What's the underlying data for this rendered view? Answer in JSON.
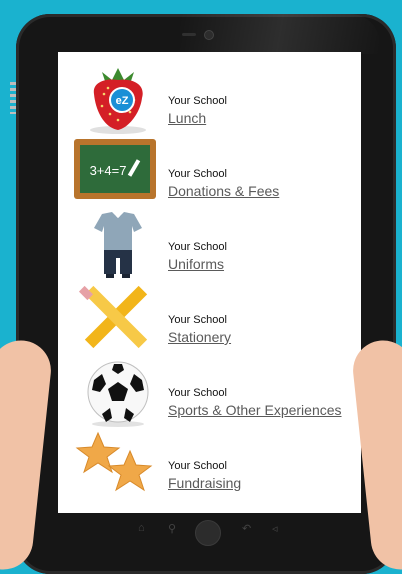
{
  "school_label": "Your School",
  "items": [
    {
      "title": "Lunch",
      "icon": "strawberry-icon"
    },
    {
      "title": "Donations & Fees",
      "icon": "chalkboard-icon"
    },
    {
      "title": "Uniforms",
      "icon": "uniform-icon"
    },
    {
      "title": "Stationery",
      "icon": "pencil-ruler-icon"
    },
    {
      "title": "Sports & Other Experiences",
      "icon": "soccer-ball-icon"
    },
    {
      "title": "Fundraising",
      "icon": "stars-icon"
    }
  ],
  "strawberry_badge": "eZ",
  "chalkboard_text": "3+4=7",
  "colors": {
    "background": "#1ab2cf",
    "tablet": "#161616",
    "link": "#5a5a5a"
  }
}
